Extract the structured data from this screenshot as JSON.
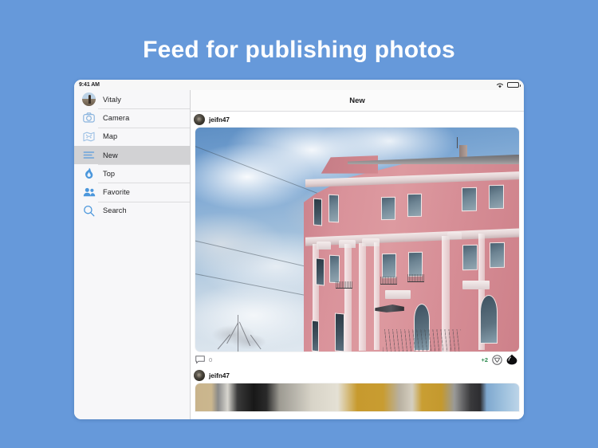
{
  "promo": {
    "title": "Feed for publishing photos"
  },
  "theme": {
    "page_background": "#6699da",
    "accent_blue": "#5b9bd5",
    "sidebar_background": "#f7f7f9",
    "selected_row": "#d2d2d4",
    "upvote_green": "#2e8b4f",
    "muted_text": "#8e8e93"
  },
  "statusbar": {
    "time": "9:41 AM",
    "wifi_icon": "wifi-icon",
    "battery_icon": "battery-icon"
  },
  "sidebar": {
    "items": [
      {
        "label": "Vitaly",
        "icon": "avatar-icon",
        "selected": false
      },
      {
        "label": "Camera",
        "icon": "camera-icon",
        "selected": false
      },
      {
        "label": "Map",
        "icon": "map-icon",
        "selected": false
      },
      {
        "label": "New",
        "icon": "list-lines-icon",
        "selected": true
      },
      {
        "label": "Top",
        "icon": "flame-icon",
        "selected": false
      },
      {
        "label": "Favorite",
        "icon": "people-icon",
        "selected": false
      },
      {
        "label": "Search",
        "icon": "search-icon",
        "selected": false
      }
    ]
  },
  "navbar": {
    "title": "New"
  },
  "feed": {
    "posts": [
      {
        "username": "jeifn47",
        "photo_description": "pink classical building with cloudy sky",
        "comment_icon": "comment-bubble-icon",
        "comment_count": "0",
        "vote_delta": "+2",
        "downvote_icon": "downvote-circle-icon",
        "upvote_icon": "upvote-filled-icon"
      },
      {
        "username": "jeifn47",
        "photo_description": "ochre building wall partial"
      }
    ]
  }
}
